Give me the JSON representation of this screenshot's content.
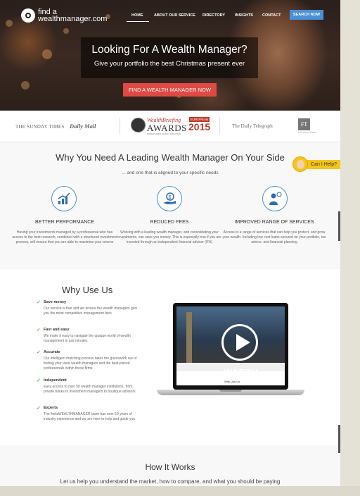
{
  "brand": {
    "line1": "find a",
    "line2": "wealthmanager.com"
  },
  "nav": {
    "items": [
      "HOME",
      "ABOUT OUR SERVICE",
      "DIRECTORY",
      "INSIGHTS",
      "CONTACT"
    ],
    "search_label": "SEARCH NOW"
  },
  "hero": {
    "title": "Looking For A Wealth Manager?",
    "subtitle": "Give your portfolio the best Christmas present ever",
    "cta": "FIND A WEALTH MANAGER NOW"
  },
  "press": {
    "sunday_times": "THE SUNDAY TIMES",
    "daily_mail": "Daily Mail",
    "wb_top": "WealthBriefing",
    "wb_european": "EUROPEAN",
    "wb_awards": "AWARDS",
    "wb_year": "2015",
    "wb_small": "SINGAPORE'S CLIENT SOLUTION",
    "telegraph": "The Daily Telegraph",
    "ft": "FT",
    "ft_small": "FINANCIAL TIMES"
  },
  "why_need": {
    "title": "Why You Need A Leading Wealth Manager On Your Side",
    "subtitle": "... and one that is aligned to your specific needs",
    "features": [
      {
        "icon": "chart-icon",
        "title": "BETTER PERFORMANCE",
        "text": "Having your investments managed by a professional who has access to the best research, combined with a structured investment process, will ensure that you are able to maximise your returns"
      },
      {
        "icon": "money-hand-icon",
        "title": "REDUCED FEES",
        "text": "Working with a leading wealth manager, and consolidating your investments, can save you money. This is especially true if you are invested through an independent financial advisor (IFA)"
      },
      {
        "icon": "adviser-icon",
        "title": "IMPROVED RANGE OF SERVICES",
        "text": "Access to a range of services that can help you protect, and grow your wealth. Including low cost loans secured on your portfolio, tax advice, and financial planning"
      }
    ]
  },
  "help": {
    "label": "Can I Help?"
  },
  "why_use": {
    "title": "Why Use Us",
    "items": [
      {
        "title": "Save money",
        "text": "Our service is free and we ensure the wealth managers give you the most competitive management fees"
      },
      {
        "title": "Fast and easy",
        "text": "We make it easy to navigate the opaque world of wealth management in just minutes"
      },
      {
        "title": "Accurate",
        "text": "Our intelligent matching process takes the guesswork out of finding your ideal wealth managers and the best-placed professionals within those firms"
      },
      {
        "title": "Independent",
        "text": "Easy access to over 50 wealth manager institutions, from private banks to investment managers to boutique advisors"
      },
      {
        "title": "Experts",
        "text": "The findaWEALTHMANAGER team has over 50 years of industry experience and we are here to help and guide you"
      }
    ],
    "video": {
      "watch_label": "WATCH",
      "screen_heading": "Why Use Us"
    }
  },
  "how": {
    "title": "How It Works",
    "subtitle": "Let us help you understand the market, how to compare, and what you should be paying"
  }
}
